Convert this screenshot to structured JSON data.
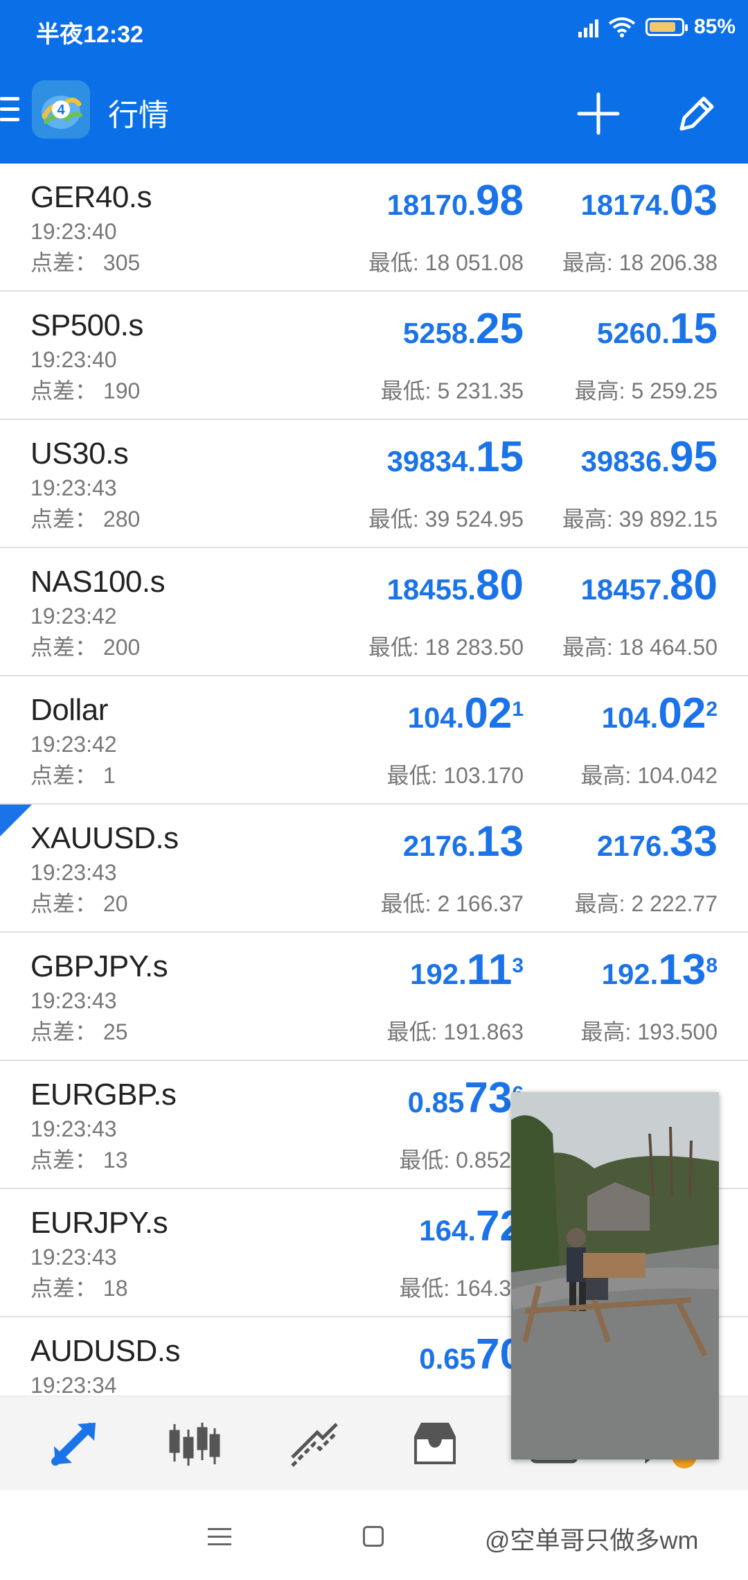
{
  "status_bar": {
    "time": "半夜12:32",
    "battery": "85%",
    "battery_level": 0.85
  },
  "toolbar": {
    "title": "行情",
    "color": "#0b6fe8"
  },
  "labels": {
    "spread": "点差：",
    "low": "最低:",
    "high": "最高:"
  },
  "quotes": [
    {
      "symbol": "GER40.s",
      "time": "19:23:40",
      "spread": "305",
      "bid": {
        "small": "18170.",
        "big": "98",
        "sup": ""
      },
      "ask": {
        "small": "18174.",
        "big": "03",
        "sup": ""
      },
      "low": "18 051.08",
      "high": "18 206.38"
    },
    {
      "symbol": "SP500.s",
      "time": "19:23:40",
      "spread": "190",
      "bid": {
        "small": "5258.",
        "big": "25",
        "sup": ""
      },
      "ask": {
        "small": "5260.",
        "big": "15",
        "sup": ""
      },
      "low": "5 231.35",
      "high": "5 259.25"
    },
    {
      "symbol": "US30.s",
      "time": "19:23:43",
      "spread": "280",
      "bid": {
        "small": "39834.",
        "big": "15",
        "sup": ""
      },
      "ask": {
        "small": "39836.",
        "big": "95",
        "sup": ""
      },
      "low": "39 524.95",
      "high": "39 892.15"
    },
    {
      "symbol": "NAS100.s",
      "time": "19:23:42",
      "spread": "200",
      "bid": {
        "small": "18455.",
        "big": "80",
        "sup": ""
      },
      "ask": {
        "small": "18457.",
        "big": "80",
        "sup": ""
      },
      "low": "18 283.50",
      "high": "18 464.50"
    },
    {
      "symbol": "Dollar",
      "time": "19:23:42",
      "spread": "1",
      "bid": {
        "small": "104.",
        "big": "02",
        "sup": "1"
      },
      "ask": {
        "small": "104.",
        "big": "02",
        "sup": "2"
      },
      "low": "103.170",
      "high": "104.042"
    },
    {
      "symbol": "XAUUSD.s",
      "time": "19:23:43",
      "spread": "20",
      "bid": {
        "small": "2176.",
        "big": "13",
        "sup": ""
      },
      "ask": {
        "small": "2176.",
        "big": "33",
        "sup": ""
      },
      "low": "2 166.37",
      "high": "2 222.77"
    },
    {
      "symbol": "GBPJPY.s",
      "time": "19:23:43",
      "spread": "25",
      "bid": {
        "small": "192.",
        "big": "11",
        "sup": "3"
      },
      "ask": {
        "small": "192.",
        "big": "13",
        "sup": "8"
      },
      "low": "191.863",
      "high": "193.500"
    },
    {
      "symbol": "EURGBP.s",
      "time": "19:23:43",
      "spread": "13",
      "bid": {
        "small": "0.85",
        "big": "73",
        "sup": "6"
      },
      "ask": {
        "small": "",
        "big": "",
        "sup": ""
      },
      "low": "0.8528",
      "high": ""
    },
    {
      "symbol": "EURJPY.s",
      "time": "19:23:43",
      "spread": "18",
      "bid": {
        "small": "164.",
        "big": "72",
        "sup": ""
      },
      "ask": {
        "small": "",
        "big": "",
        "sup": ""
      },
      "low": "164.33",
      "high": ""
    },
    {
      "symbol": "AUDUSD.s",
      "time": "19:23:34",
      "spread": "",
      "bid": {
        "small": "0.65",
        "big": "70",
        "sup": ""
      },
      "ask": {
        "small": "",
        "big": "",
        "sup": ""
      },
      "low": "",
      "high": ""
    }
  ],
  "bottom_nav": [
    {
      "name": "nav-quotes-button",
      "icon": "quotes-arrows-icon",
      "active": true
    },
    {
      "name": "nav-chart-button",
      "icon": "candlestick-icon",
      "active": false
    },
    {
      "name": "nav-trade-button",
      "icon": "trade-trend-icon",
      "active": false
    },
    {
      "name": "nav-history-button",
      "icon": "inbox-icon",
      "active": false
    }
  ],
  "system_nav": {
    "watermark": "@空单哥只做多wm"
  }
}
